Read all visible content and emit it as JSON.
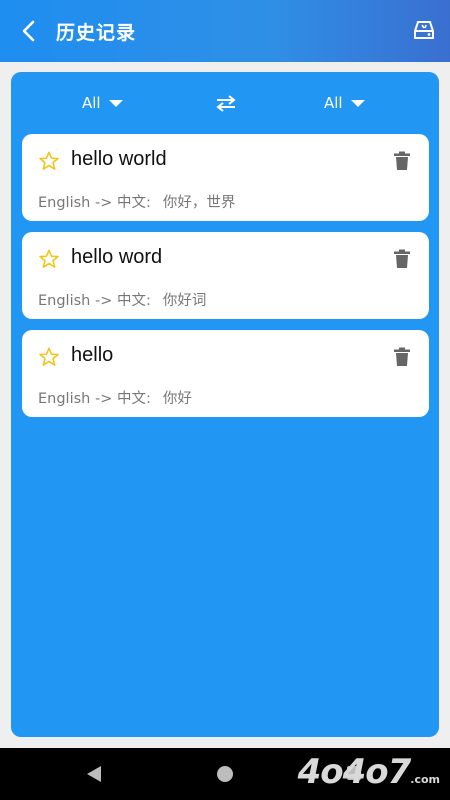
{
  "header": {
    "title": "历史记录",
    "back_icon": "chevron-left-icon",
    "action_icon": "clear-history-icon"
  },
  "language_bar": {
    "source": "All",
    "target": "All",
    "swap_icon": "swap-icon"
  },
  "history": [
    {
      "word": "hello world",
      "direction": "English -> 中文:",
      "translation": "你好，世界",
      "starred": false
    },
    {
      "word": "hello word",
      "direction": "English -> 中文:",
      "translation": "你好词",
      "starred": false
    },
    {
      "word": "hello",
      "direction": "English -> 中文:",
      "translation": "你好",
      "starred": false
    }
  ],
  "watermark": {
    "text": "4o4o7",
    "suffix": ".com"
  },
  "colors": {
    "primary": "#2196f3",
    "app_bar": "#1e8ef0",
    "star": "#f3c316",
    "trash": "#666666"
  }
}
